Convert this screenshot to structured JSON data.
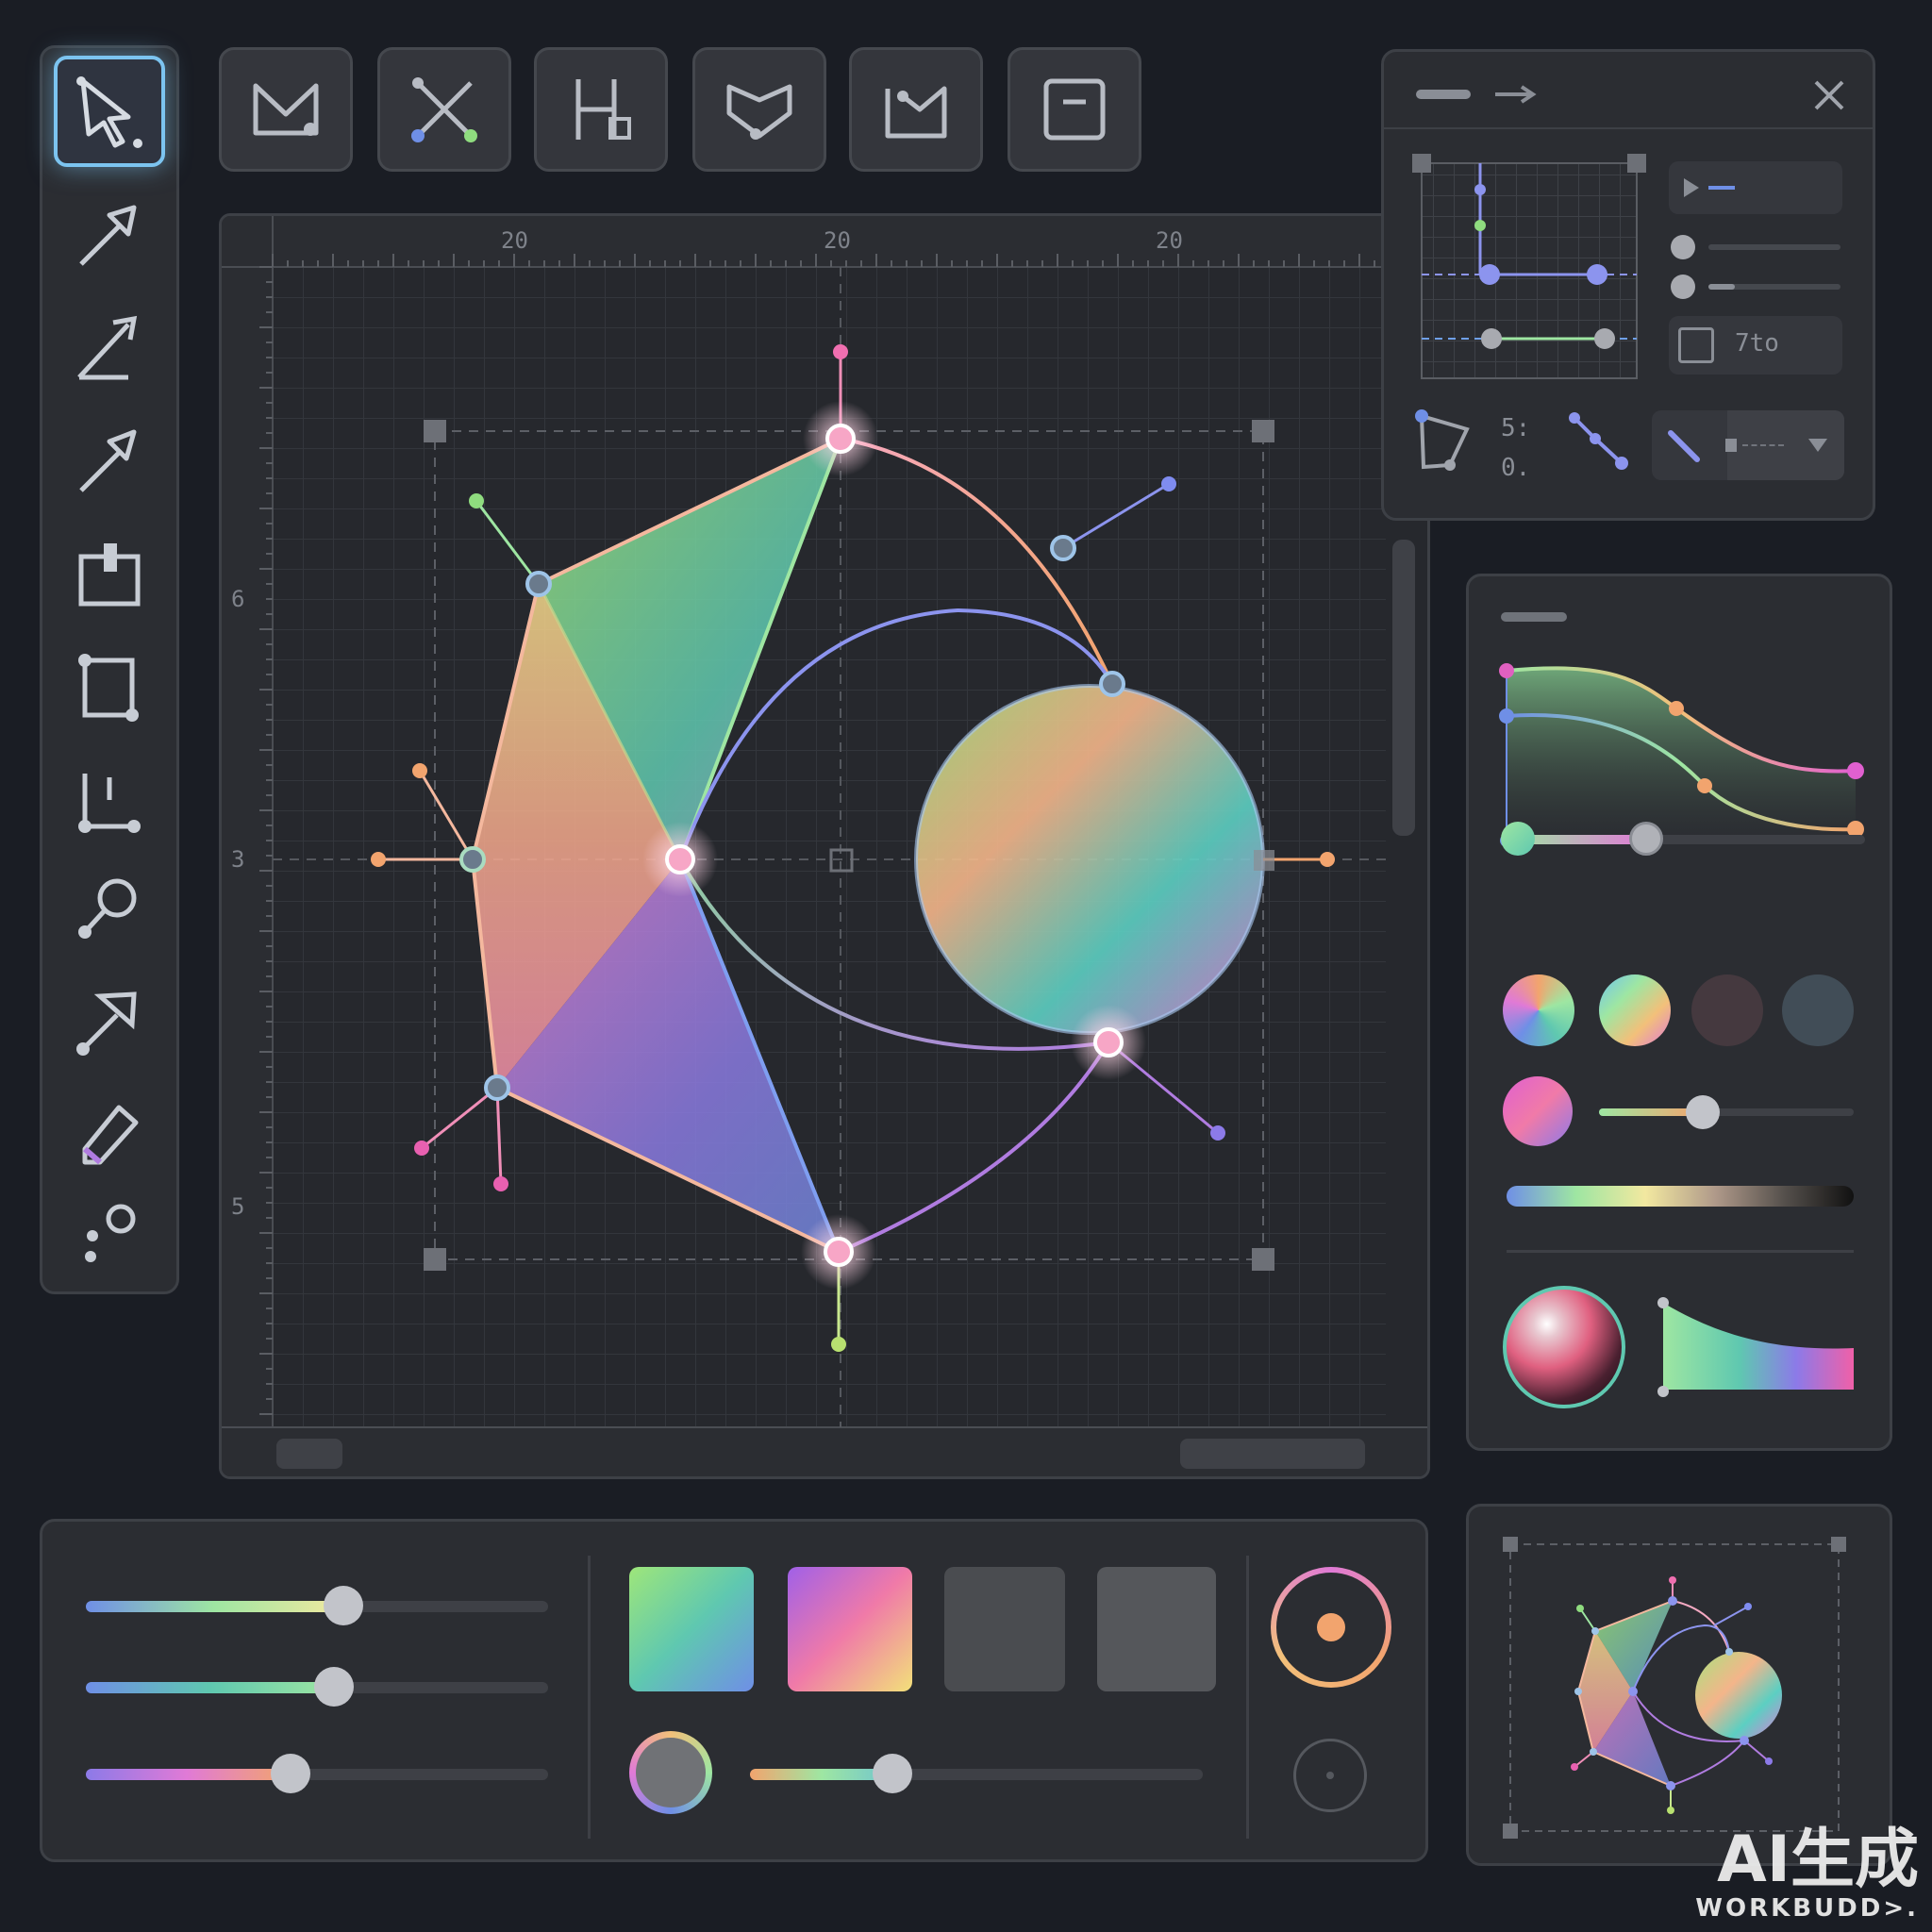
{
  "canvas": {
    "ruler_top_labels": [
      "20",
      "20",
      "20"
    ],
    "ruler_left_labels": [
      "6",
      "3",
      "5"
    ]
  },
  "properties_panel": {
    "field_value": "7to",
    "coord_labels": [
      "5:",
      "0."
    ]
  },
  "toolbar": {
    "tools": [
      "select-icon",
      "pen-icon",
      "line-icon",
      "arrow-pen-icon",
      "frame-icon",
      "rectangle-node-icon",
      "node-align-icon",
      "magnifier-node-icon",
      "node-edit-icon",
      "eraser-icon",
      "scatter-points-icon"
    ]
  },
  "top_tools": [
    "envelope-node-icon",
    "intersect-icon",
    "align-nodes-icon",
    "heart-shape-icon",
    "chart-node-icon",
    "minus-box-icon"
  ],
  "colors": {
    "accent": "#7cc4f0",
    "background": "#1a1d24",
    "panel": "#2b2d32"
  },
  "watermark": {
    "line1": "AI生成",
    "line2": "WORKBUDD>."
  }
}
